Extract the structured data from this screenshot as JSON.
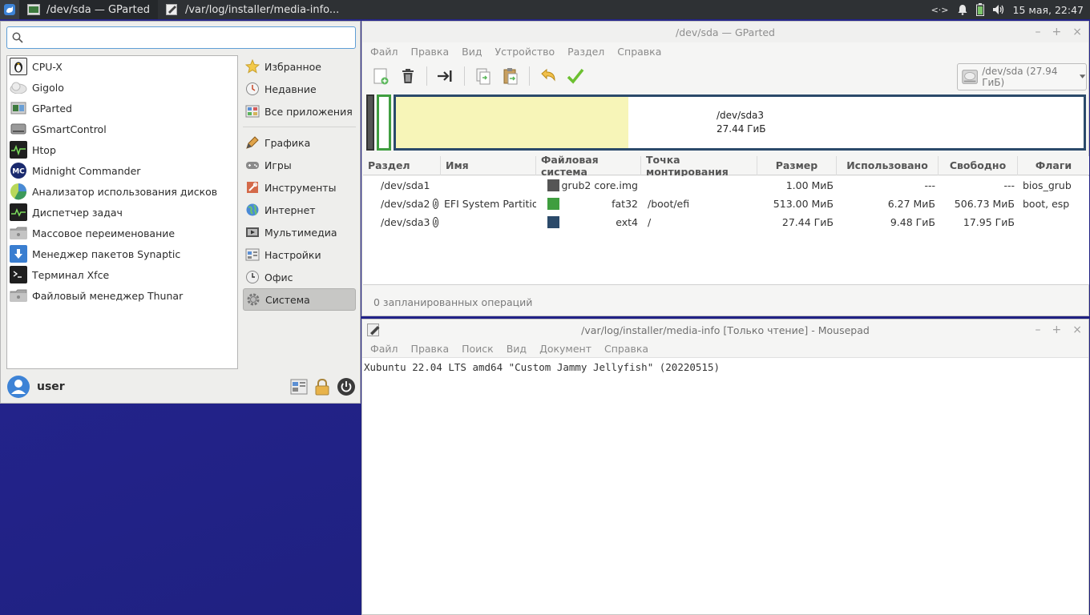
{
  "panel": {
    "tasks": [
      {
        "label": "/dev/sda — GParted",
        "icon": "gparted-icon",
        "active": true
      },
      {
        "label": "/var/log/installer/media-info...",
        "icon": "text-editor-icon",
        "active": false
      }
    ],
    "clock": "15 мая, 22:47"
  },
  "menu": {
    "search": {
      "value": "",
      "placeholder": ""
    },
    "apps": [
      {
        "label": "CPU-X",
        "icon": "penguin-icon",
        "color": "#333333"
      },
      {
        "label": "Gigolo",
        "icon": "cloud-icon",
        "color": "#dddddd"
      },
      {
        "label": "GParted",
        "icon": "gparted-icon",
        "color": "#3d7a3d"
      },
      {
        "label": "GSmartControl",
        "icon": "harddisk-icon",
        "color": "#888888"
      },
      {
        "label": "Htop",
        "icon": "monitor-graph-icon",
        "color": "#1f1f1f"
      },
      {
        "label": "Midnight Commander",
        "icon": "mc-icon",
        "color": "#1a2a6e"
      },
      {
        "label": "Анализатор использования дисков",
        "icon": "pie-chart-icon",
        "color": "#4a8a4a"
      },
      {
        "label": "Диспетчер задач",
        "icon": "task-manager-icon",
        "color": "#1f1f1f"
      },
      {
        "label": "Массовое переименование",
        "icon": "folder-icon",
        "color": "#9a9a9a"
      },
      {
        "label": "Менеджер пакетов Synaptic",
        "icon": "download-icon",
        "color": "#3a7ed0"
      },
      {
        "label": "Терминал Xfce",
        "icon": "terminal-icon",
        "color": "#1f1f1f"
      },
      {
        "label": "Файловый менеджер Thunar",
        "icon": "folder-icon",
        "color": "#9a9a9a"
      }
    ],
    "favorites": [
      {
        "label": "Избранное",
        "icon": "star-icon"
      },
      {
        "label": "Недавние",
        "icon": "clock-icon"
      },
      {
        "label": "Все приложения",
        "icon": "all-apps-icon"
      }
    ],
    "categories": [
      {
        "label": "Графика",
        "icon": "graphics-icon",
        "selected": false
      },
      {
        "label": "Игры",
        "icon": "gamepad-icon",
        "selected": false
      },
      {
        "label": "Инструменты",
        "icon": "tools-icon",
        "selected": false
      },
      {
        "label": "Интернет",
        "icon": "globe-icon",
        "selected": false
      },
      {
        "label": "Мультимедиа",
        "icon": "multimedia-icon",
        "selected": false
      },
      {
        "label": "Настройки",
        "icon": "settings-icon",
        "selected": false
      },
      {
        "label": "Офис",
        "icon": "office-icon",
        "selected": false
      },
      {
        "label": "Система",
        "icon": "gear-icon",
        "selected": true
      }
    ],
    "user": "user"
  },
  "gparted": {
    "title": "/dev/sda — GParted",
    "menu": [
      "Файл",
      "Правка",
      "Вид",
      "Устройство",
      "Раздел",
      "Справка"
    ],
    "device": "/dev/sda (27.94 ГиБ)",
    "map_label": {
      "name": "/dev/sda3",
      "size": "27.44 ГиБ"
    },
    "map_used_fraction": 0.338,
    "columns": [
      "Раздел",
      "Имя",
      "Файловая система",
      "Точка монтирования",
      "Размер",
      "Использовано",
      "Свободно",
      "Флаги"
    ],
    "rows": [
      {
        "partition": "/dev/sda1",
        "key": false,
        "name": "",
        "fs_color": "#555555",
        "fs": "grub2 core.img",
        "mount": "",
        "size": "1.00 МиБ",
        "used": "---",
        "free": "---",
        "flags": "bios_grub"
      },
      {
        "partition": "/dev/sda2",
        "key": true,
        "name": "EFI System Partition",
        "fs_color": "#3f9e3f",
        "fs": "fat32",
        "mount": "/boot/efi",
        "size": "513.00 МиБ",
        "used": "6.27 МиБ",
        "free": "506.73 МиБ",
        "flags": "boot, esp"
      },
      {
        "partition": "/dev/sda3",
        "key": true,
        "name": "",
        "fs_color": "#2b4a6a",
        "fs": "ext4",
        "mount": "/",
        "size": "27.44 ГиБ",
        "used": "9.48 ГиБ",
        "free": "17.95 ГиБ",
        "flags": ""
      }
    ],
    "status": "0 запланированных операций"
  },
  "mousepad": {
    "title": "/var/log/installer/media-info [Только чтение] - Mousepad",
    "menu": [
      "Файл",
      "Правка",
      "Поиск",
      "Вид",
      "Документ",
      "Справка"
    ],
    "content": "Xubuntu 22.04 LTS amd64 \"Custom Jammy Jellyfish\" (20220515)"
  }
}
